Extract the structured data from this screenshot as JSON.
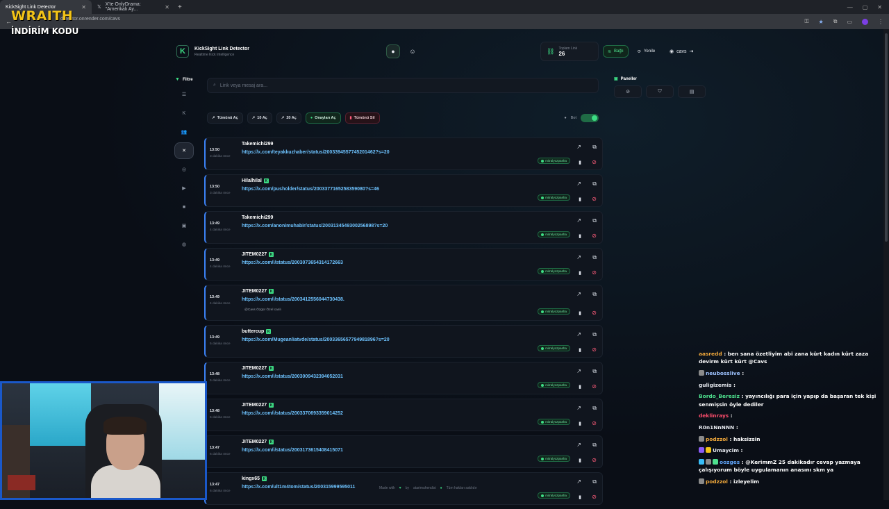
{
  "browser": {
    "tabs": [
      {
        "label": "KickSight Link Detector",
        "active": true
      },
      {
        "label": "X'te OnlyDrama: \"Amerikalı Ay...",
        "active": false
      }
    ],
    "url": "detector.onrender.com/cavs"
  },
  "overlay": {
    "logo": "WRAITH",
    "subtitle": "İNDİRİM KODU"
  },
  "header": {
    "brand_title": "KickSight Link Detector",
    "brand_subtitle": "Realtime Kick Intelligence",
    "total_label": "Toplam Link",
    "total_value": "26",
    "connect_label": "Bağlı",
    "refresh_label": "Yenile",
    "user_label": "cavs"
  },
  "filter": {
    "label": "Filtre",
    "nav_icons": [
      "list-icon",
      "kick-icon",
      "users-icon",
      "x-icon",
      "instagram-icon",
      "youtube-icon",
      "video-icon",
      "camera-icon",
      "globe-icon"
    ]
  },
  "search": {
    "placeholder": "Link veya mesaj ara..."
  },
  "actions": {
    "open_all": "Tümünü Aç",
    "open_10": "10 Aç",
    "open_20": "20 Aç",
    "open_approved": "Onayları Aç",
    "delete_all": "Tümünü Sil",
    "bot_label": "Bot",
    "bot_on": true
  },
  "panels": {
    "title": "Paneller"
  },
  "links": [
    {
      "time": "13:50",
      "ago": "3 dakika önce",
      "user": "Takemichi299",
      "kick": false,
      "url": "https://x.com/teyakkuzhaber/status/2003394557745201462?s=20",
      "tag": "mitralyozpasha"
    },
    {
      "time": "13:50",
      "ago": "3 dakika önce",
      "user": "Hilalhilal",
      "kick": true,
      "url": "https://x.com/pusholder/status/2003377165258359080?s=46",
      "tag": "mitralyozpasha"
    },
    {
      "time": "13:49",
      "ago": "4 dakika önce",
      "user": "Takemichi299",
      "kick": false,
      "url": "https://x.com/anonimuhabir/status/2003134549300256898?s=20",
      "tag": "mitralyozpasha"
    },
    {
      "time": "13:49",
      "ago": "4 dakika önce",
      "user": "JITEM0227",
      "kick": true,
      "url": "https://x.com/i/status/2003073654314172663",
      "tag": "mitralyozpasha"
    },
    {
      "time": "13:49",
      "ago": "4 dakika önce",
      "user": "JITEM0227",
      "kick": true,
      "url": "https://x.com/i/status/2003412556044730438.",
      "tag": "mitralyozpasha",
      "note": "@Cavs Özgür Özel canlı"
    },
    {
      "time": "13:49",
      "ago": "5 dakika önce",
      "user": "buttercup",
      "kick": true,
      "url": "https://x.com/Mugeanliatvde/status/2003365657794981896?s=20",
      "tag": "mitralyozpasha"
    },
    {
      "time": "13:48",
      "ago": "5 dakika önce",
      "user": "JITEM0227",
      "kick": true,
      "url": "https://x.com/i/status/2003009432394052031",
      "tag": "mitralyozpasha"
    },
    {
      "time": "13:48",
      "ago": "5 dakika önce",
      "user": "JITEM0227",
      "kick": true,
      "url": "https://x.com/i/status/2003370693359014252",
      "tag": "mitralyozpasha"
    },
    {
      "time": "13:47",
      "ago": "6 dakika önce",
      "user": "JITEM0227",
      "kick": true,
      "url": "https://x.com/i/status/2003173615408415071",
      "tag": "mitralyozpasha"
    },
    {
      "time": "13:47",
      "ago": "6 dakika önce",
      "user": "kingx65",
      "kick": true,
      "url": "https://x.com/ult1m4tom/status/200315999595011",
      "tag": "mitralyozpasha"
    }
  ],
  "footer": {
    "made_with": "Made with",
    "by": "by",
    "author": "atarimuhendisi",
    "rights": "Tüm hakları saklıdır"
  },
  "chat": [
    {
      "user": "aasredd",
      "color": "#f2a93b",
      "text": ": ben sana özetliyim abi zana kürt kadın kürt zaza devirm kürt kürt @Cavs",
      "badges": []
    },
    {
      "user": "neubosslive",
      "color": "#9ec3ff",
      "text": ":",
      "badges": [
        "#8a8a8a"
      ]
    },
    {
      "user": "guligizemis",
      "color": "#e6e9ef",
      "text": ":",
      "badges": []
    },
    {
      "user": "Bordo_Beresiz",
      "color": "#4ee08e",
      "text": ": yayıncılığı para için yapıp da başaran tek kişi senmişsin öyle dediler",
      "badges": []
    },
    {
      "user": "deklinrays",
      "color": "#ff4d6d",
      "text": ":",
      "badges": []
    },
    {
      "user": "R0n1NnNNN",
      "color": "#e6e9ef",
      "text": ":",
      "badges": []
    },
    {
      "user": "podzzol",
      "color": "#f2a93b",
      "text": ": haksizsin",
      "badges": [
        "#8a8a8a"
      ]
    },
    {
      "user": "Umaycim",
      "color": "#e6e9ef",
      "text": ":",
      "badges": [
        "#8b5cf6",
        "#f2c318"
      ]
    },
    {
      "user": "oozges",
      "color": "#60a5fa",
      "text": ": @KerimmZ 25 dakikadır cevap yazmaya çalışıyorum böyle uygulamanın anasını skm ya",
      "badges": [
        "#38bdf8",
        "#8a8a8a",
        "#4ee08e"
      ]
    },
    {
      "user": "podzzol",
      "color": "#f2a93b",
      "text": ": izleyelim",
      "badges": [
        "#8a8a8a"
      ]
    }
  ]
}
